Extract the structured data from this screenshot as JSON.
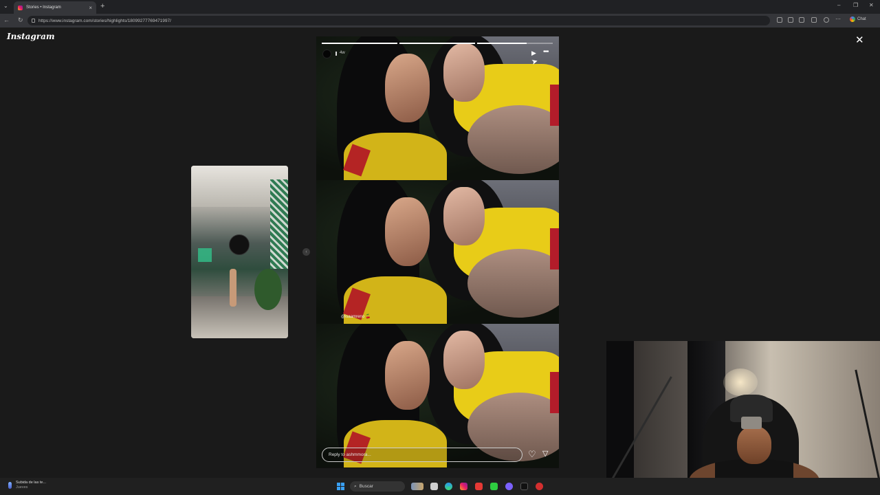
{
  "browser": {
    "tab_title": "Stories • Instagram",
    "tab_close": "×",
    "new_tab": "+",
    "url": "https://www.instagram.com/stories/highlights/18099277769471997/",
    "chat_label": "Chat",
    "nav": {
      "back": "←",
      "forward": "→",
      "reload": "↻"
    },
    "window": {
      "minimize": "–",
      "restore": "❐",
      "close": "✕"
    }
  },
  "instagram": {
    "logo": "Instagram",
    "close": "✕",
    "story": {
      "time_ago": "4w",
      "mention": "@isaamreno 🍒",
      "reply_placeholder": "Reply to ashmmora...",
      "progress_segments": 3,
      "current_segment": 3
    }
  },
  "taskbar": {
    "notification_title": "Subida de las te...",
    "notification_sub": "Jueves",
    "search_label": "Buscar"
  },
  "icons": [
    "tab-search-icon",
    "back-icon",
    "forward-icon",
    "reload-icon",
    "lock-icon",
    "play-icon",
    "more-icon",
    "heart-icon",
    "send-icon",
    "close-icon",
    "windows-start-icon",
    "search-icon",
    "mic-icon"
  ],
  "colors": {
    "background": "#1a1a1a",
    "accent": "#ffffff",
    "browser_chrome": "#202124"
  }
}
